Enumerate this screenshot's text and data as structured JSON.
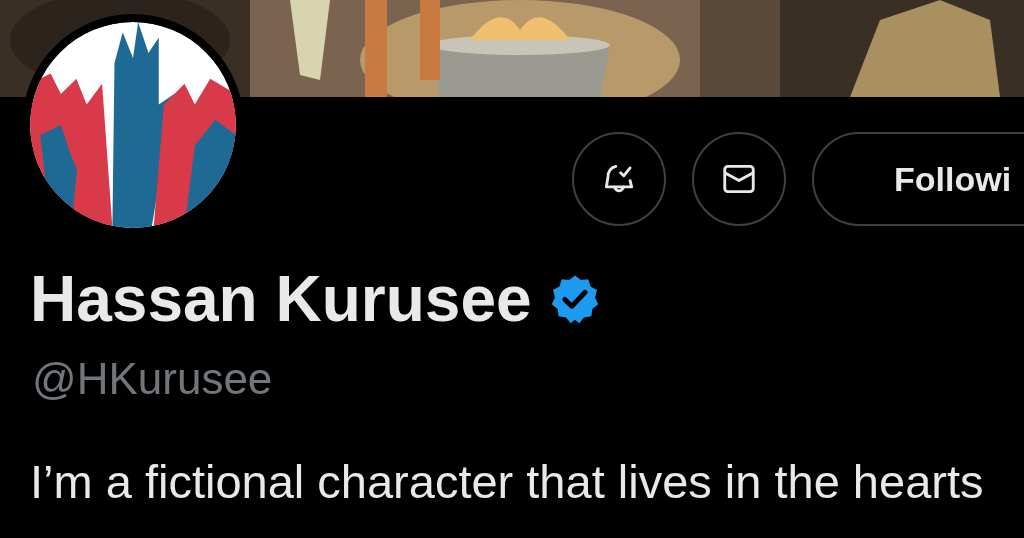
{
  "actions": [
    {
      "kind": "notify",
      "subscribed": true
    },
    {
      "kind": "message"
    }
  ],
  "follow_button": {
    "label": "Followi"
  },
  "profile": {
    "name": "Hassan Kurusee",
    "verified": true,
    "handle": "@HKurusee"
  },
  "bio": "I’m a fictional character that lives in the hearts"
}
